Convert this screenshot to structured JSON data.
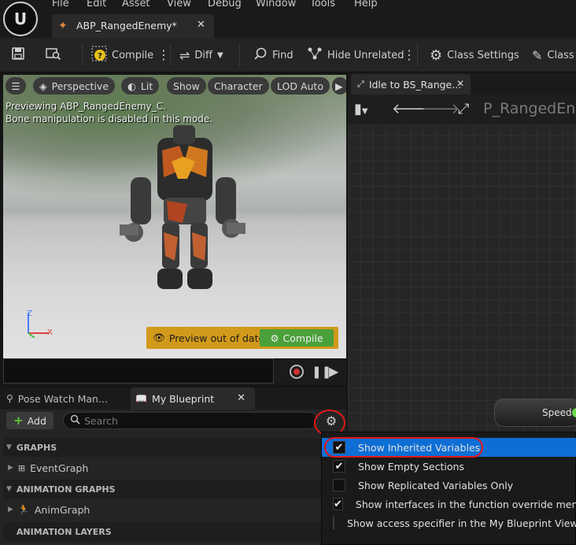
{
  "menu": [
    "File",
    "Edit",
    "Asset",
    "View",
    "Debug",
    "Window",
    "Tools",
    "Help"
  ],
  "document_tab": {
    "label": "ABP_RangedEnemy*"
  },
  "toolbar": {
    "compile": "Compile",
    "diff": "Diff",
    "find": "Find",
    "hide_unrelated": "Hide Unrelated",
    "class_settings": "Class Settings",
    "class_defaults": "Class"
  },
  "viewport": {
    "perspective": "Perspective",
    "lit": "Lit",
    "show": "Show",
    "character": "Character",
    "lod": "LOD Auto",
    "notice_1": "Previewing ABP_RangedEnemy_C.",
    "notice_2": "Bone manipulation is disabled in this mode.",
    "axis_z": "Z",
    "axis_x": "X",
    "preview_out_of_date": "Preview out of date",
    "preview_compile": "Compile"
  },
  "panel": {
    "tab_pose": "Pose Watch Man...",
    "tab_mybp": "My Blueprint",
    "add": "Add",
    "search_placeholder": "Search",
    "sections": {
      "graphs": "GRAPHS",
      "event_graph": "EventGraph",
      "animation_graphs": "ANIMATION GRAPHS",
      "anim_graph": "AnimGraph",
      "animation_layers": "ANIMATION LAYERS"
    }
  },
  "graph": {
    "tab": "Idle to BS_Range...",
    "title": "P_RangedEne",
    "speed_node": "Speed"
  },
  "dropdown": [
    {
      "label": "Show Inherited Variables",
      "checked": true,
      "selected": true
    },
    {
      "label": "Show Empty Sections",
      "checked": true,
      "selected": false
    },
    {
      "label": "Show Replicated Variables Only",
      "checked": false,
      "selected": false
    },
    {
      "label": "Show interfaces in the function override menu",
      "checked": true,
      "selected": false
    },
    {
      "label": "Show access specifier in the My Blueprint View",
      "checked": false,
      "selected": false
    }
  ],
  "colors": {
    "accent": "#0d6fd6",
    "annotation_red": "#e01818",
    "warning": "#d29a1a",
    "compile_green": "#4aa03a"
  }
}
